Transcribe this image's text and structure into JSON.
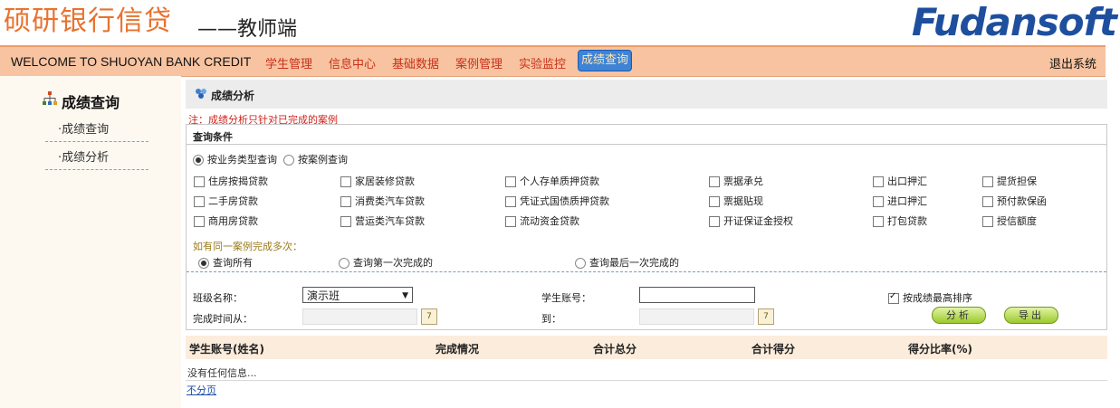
{
  "header": {
    "brand_title": "硕研银行信贷",
    "brand_sub": "——教师端",
    "logo": "Fudansoft"
  },
  "nav": {
    "welcome": "WELCOME TO SHUOYAN BANK CREDIT",
    "items": [
      "学生管理",
      "信息中心",
      "基础数据",
      "案例管理",
      "实验监控"
    ],
    "active": "成绩查询",
    "logout": "退出系统"
  },
  "sidebar": {
    "title": "成绩查询",
    "items": [
      "成绩查询",
      "成绩分析"
    ]
  },
  "panel": {
    "title": "成绩分析",
    "note": "注：成绩分析只针对已完成的案例",
    "query_label": "查询条件",
    "mode_options": [
      "按业务类型查询",
      "按案例查询"
    ],
    "business_types": [
      [
        "住房按揭贷款",
        "家居装修贷款",
        "个人存单质押贷款",
        "票据承兑",
        "出口押汇",
        "提货担保"
      ],
      [
        "二手房贷款",
        "消费类汽车贷款",
        "凭证式国债质押贷款",
        "票据贴现",
        "进口押汇",
        "预付款保函"
      ],
      [
        "商用房贷款",
        "营运类汽车贷款",
        "流动资金贷款",
        "开证保证金授权",
        "打包贷款",
        "授信额度"
      ]
    ],
    "multi_hint": "如有同一案例完成多次：",
    "multi_options": [
      "查询所有",
      "查询第一次完成的",
      "查询最后一次完成的"
    ],
    "class_label": "班级名称：",
    "class_value": "演示班",
    "student_label": "学生账号：",
    "student_value": "",
    "sort_label": "按成绩最高排序",
    "time_from_label": "完成时间从：",
    "time_to_label": "到：",
    "analyze_button": "分析",
    "export_button": "导出"
  },
  "table": {
    "columns": [
      "学生账号(姓名)",
      "完成情况",
      "合计总分",
      "合计得分",
      "得分比率(%)"
    ],
    "empty_text": "没有任何信息...",
    "pager": "不分页"
  },
  "colors": {
    "brand": "#e8722e",
    "logo": "#1e4f9e",
    "nav_bg": "#f8c3a0",
    "nav_link": "#c8311b",
    "note": "#d0221a",
    "button": "#9ac92b"
  }
}
